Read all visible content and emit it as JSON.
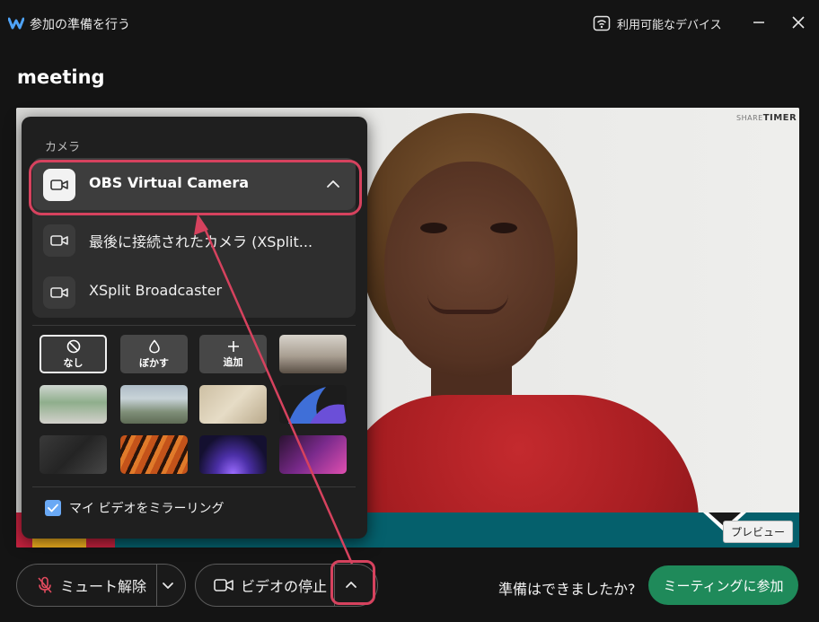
{
  "titlebar": {
    "title": "参加の準備を行う",
    "devices_label": "利用可能なデバイス"
  },
  "meeting": {
    "title": "meeting"
  },
  "preview": {
    "badge": "プレビュー",
    "brand_bold": "TIMER",
    "brand_thin": "SHARE"
  },
  "camera_panel": {
    "heading": "カメラ",
    "cameras": [
      {
        "label": "OBS Virtual Camera",
        "selected": true
      },
      {
        "label": "最後に接続されたカメラ (XSplit..."
      },
      {
        "label": "XSplit Broadcaster"
      }
    ],
    "background_options": [
      {
        "label": "なし",
        "icon": "ban-icon",
        "active": true
      },
      {
        "label": "ぼかす",
        "icon": "droplet-icon"
      },
      {
        "label": "追加",
        "icon": "plus-icon"
      }
    ],
    "mirror_label": "マイ ビデオをミラーリング",
    "mirror_checked": true
  },
  "bottom_bar": {
    "mute_label": "ミュート解除",
    "video_label": "ビデオの停止",
    "ready_text": "準備はできましたか?",
    "join_label": "ミーティングに参加"
  },
  "colors": {
    "accent_highlight": "#d6425e",
    "join_green": "#1f8a5a",
    "checkbox_blue": "#6aa9f5",
    "brand_teal": "#05606c"
  }
}
